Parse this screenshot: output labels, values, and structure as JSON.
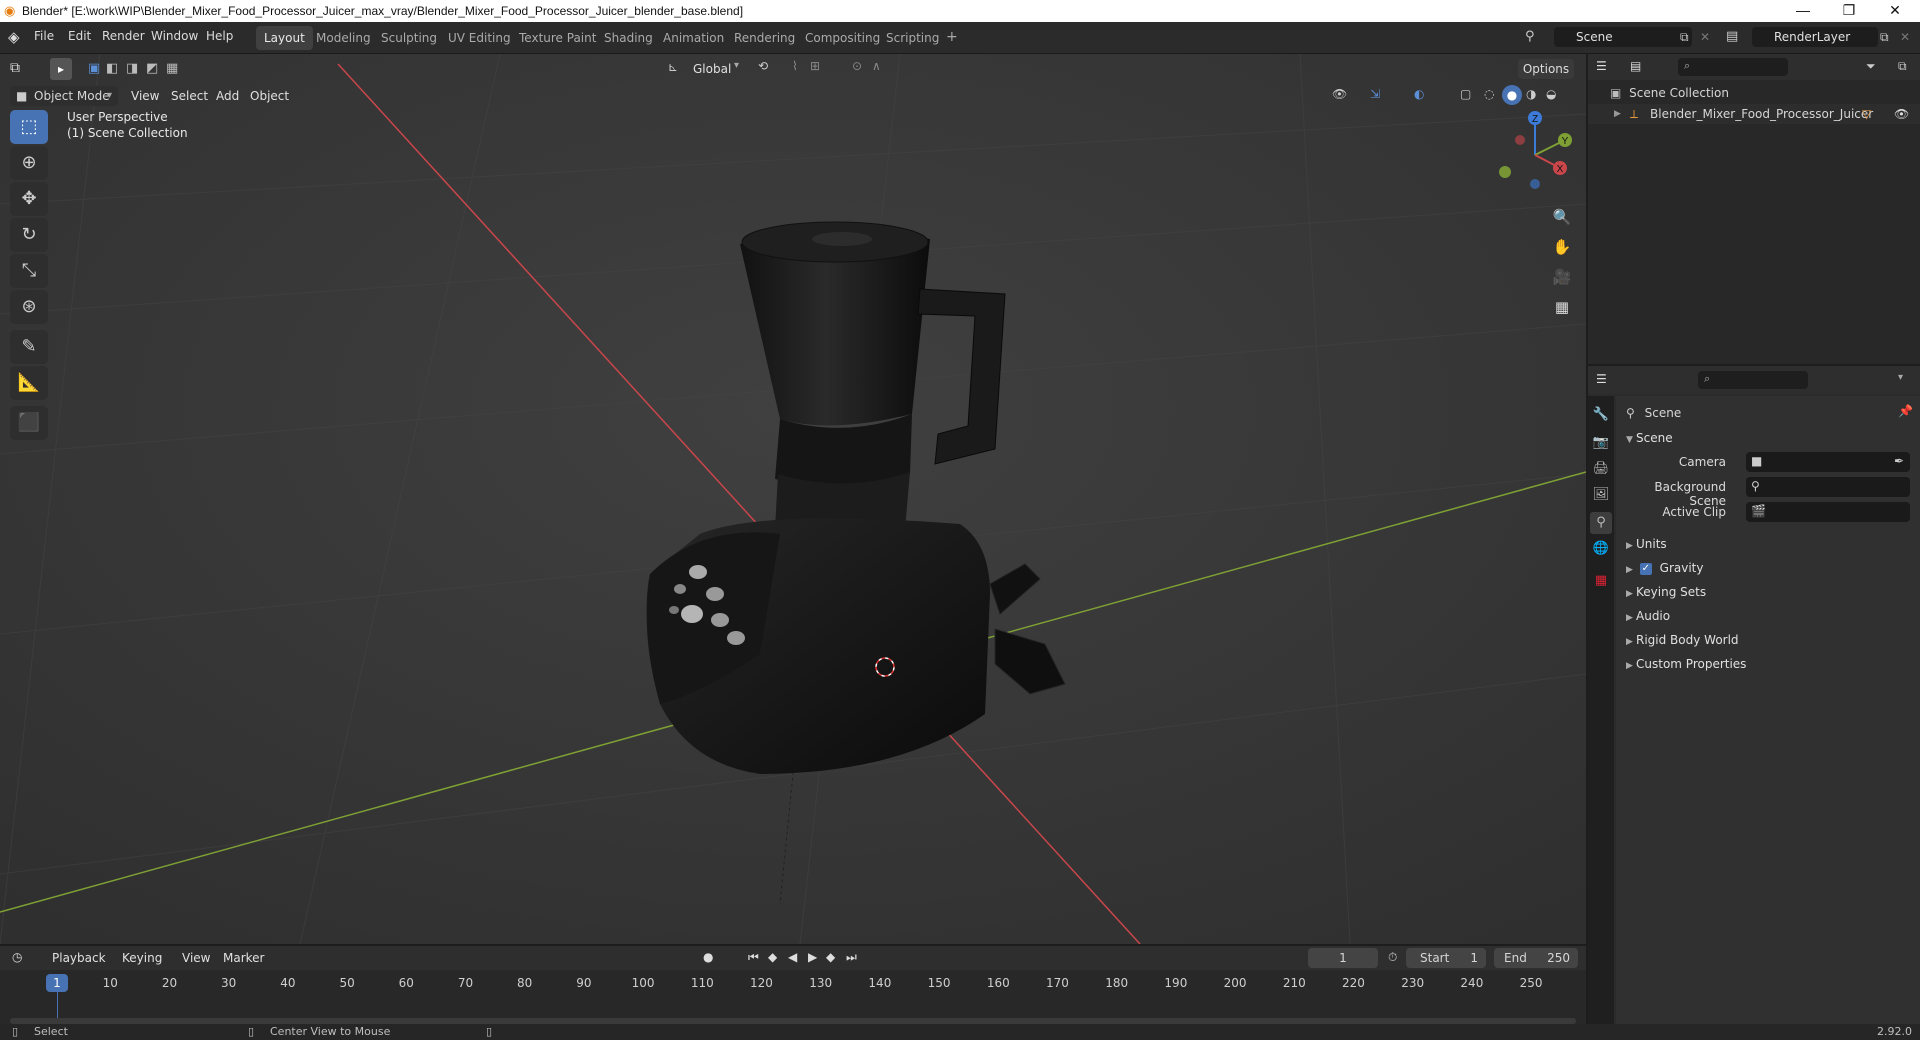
{
  "window": {
    "title": "Blender* [E:\\work\\WIP\\Blender_Mixer_Food_Processor_Juicer_max_vray/Blender_Mixer_Food_Processor_Juicer_blender_base.blend]"
  },
  "menu": [
    "File",
    "Edit",
    "Render",
    "Window",
    "Help"
  ],
  "workspaces": [
    "Layout",
    "Modeling",
    "Sculpting",
    "UV Editing",
    "Texture Paint",
    "Shading",
    "Animation",
    "Rendering",
    "Compositing",
    "Scripting"
  ],
  "active_workspace": "Layout",
  "scene_field": "Scene",
  "render_layer_field": "RenderLayer",
  "viewport": {
    "mode": "Object Mode",
    "menus": [
      "View",
      "Select",
      "Add",
      "Object"
    ],
    "orientation": "Global",
    "options_label": "Options",
    "overlay_line1": "User Perspective",
    "overlay_line2": "(1) Scene Collection",
    "gizmo_axes": [
      "Z",
      "Y",
      "X"
    ]
  },
  "outliner": {
    "root": "Scene Collection",
    "items": [
      {
        "name": "Blender_Mixer_Food_Processor_Juicer"
      }
    ]
  },
  "properties": {
    "header": "Scene",
    "section": "Scene",
    "camera_label": "Camera",
    "background_scene_label": "Background Scene",
    "active_clip_label": "Active Clip",
    "panels": [
      "Units",
      "Gravity",
      "Keying Sets",
      "Audio",
      "Rigid Body World",
      "Custom Properties"
    ],
    "gravity_checked": true
  },
  "timeline": {
    "menus": [
      "Playback",
      "Keying",
      "View",
      "Marker"
    ],
    "current_frame": "1",
    "start_label": "Start",
    "start_value": "1",
    "end_label": "End",
    "end_value": "250",
    "ruler": [
      "1",
      "10",
      "20",
      "30",
      "40",
      "50",
      "60",
      "70",
      "80",
      "90",
      "100",
      "110",
      "120",
      "130",
      "140",
      "150",
      "160",
      "170",
      "180",
      "190",
      "200",
      "210",
      "220",
      "230",
      "240",
      "250"
    ]
  },
  "statusbar": {
    "left": "Select",
    "middle": "Center View to Mouse",
    "version": "2.92.0"
  },
  "colors": {
    "accent": "#4772b3",
    "x_axis": "#c9464b",
    "y_axis": "#7ea034",
    "z_axis": "#3c7bd8"
  }
}
